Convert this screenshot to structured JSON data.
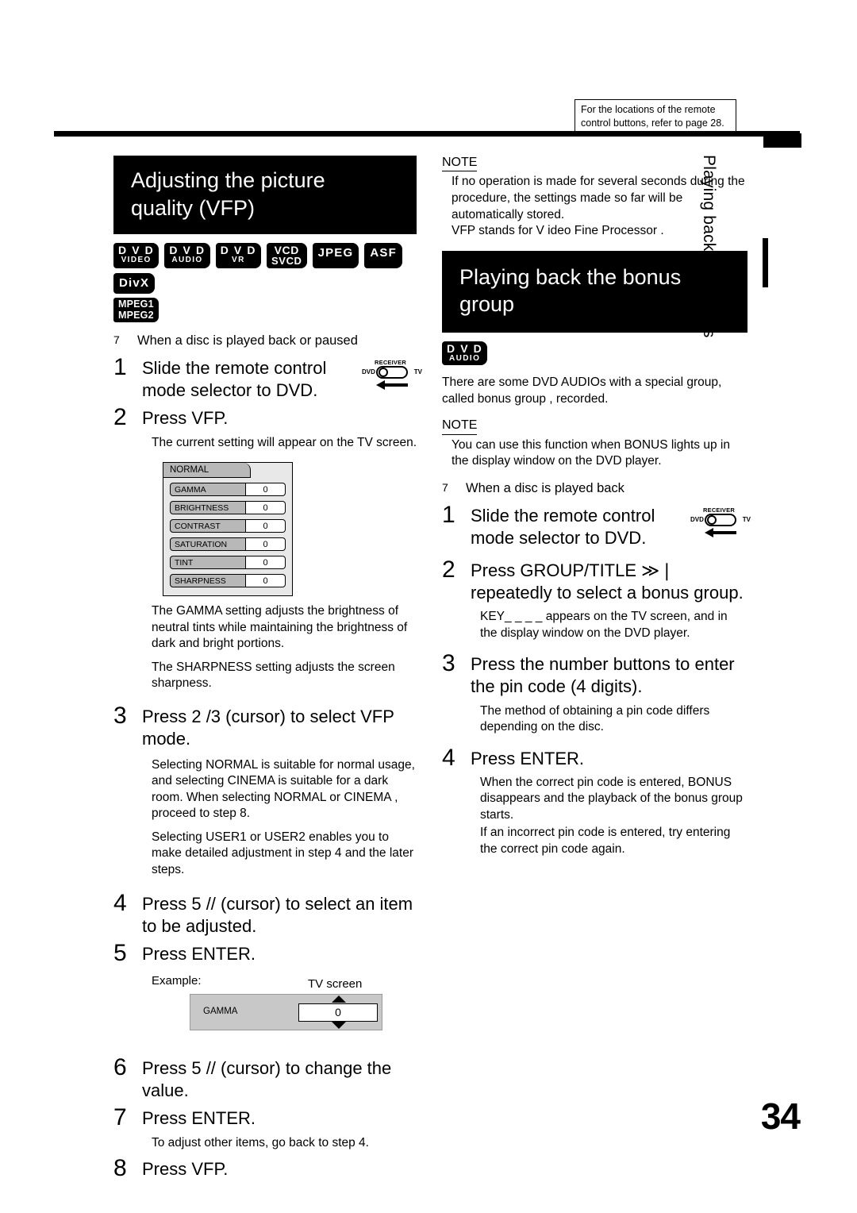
{
  "page": {
    "number": "34",
    "side_tab": "Playing back DVDs/CDs"
  },
  "remote_note": {
    "line1": "For the locations of the remote",
    "line2": "control buttons, refer to page 28."
  },
  "left_column": {
    "banner": {
      "line1": "Adjusting the picture",
      "line2": "quality (VFP)"
    },
    "badges": [
      {
        "top": "D V D",
        "bottom": "VIDEO"
      },
      {
        "top": "D V D",
        "bottom": "AUDIO"
      },
      {
        "top": "D V D",
        "bottom": "VR"
      },
      {
        "top": "VCD",
        "bottom": "SVCD"
      },
      {
        "top": "JPEG",
        "bottom": ""
      },
      {
        "top": "ASF",
        "bottom": ""
      },
      {
        "top": "DivX",
        "bottom": ""
      }
    ],
    "badges_row2": [
      {
        "top": "MPEG1",
        "bottom": "MPEG2"
      }
    ],
    "precondition": {
      "bullet": "7",
      "text": "When a disc is played back or paused"
    },
    "steps": [
      {
        "num": "1",
        "text": "Slide the remote control mode selector to DVD."
      },
      {
        "num": "2",
        "text": "Press VFP."
      },
      {
        "num": "3",
        "text": "Press  2 /3  (cursor) to select VFP mode."
      },
      {
        "num": "4",
        "text": "Press 5 //   (cursor) to select an item to be adjusted."
      },
      {
        "num": "5",
        "text": "Press ENTER."
      },
      {
        "num": "6",
        "text": "Press  5 //   (cursor) to change the value."
      },
      {
        "num": "7",
        "text": "Press ENTER."
      },
      {
        "num": "8",
        "text": "Press VFP."
      }
    ],
    "step2_note": "The current setting will appear on the TV screen.",
    "osd_menu": {
      "mode": "NORMAL",
      "rows": [
        {
          "label": "GAMMA",
          "value": "0"
        },
        {
          "label": "BRIGHTNESS",
          "value": "0"
        },
        {
          "label": "CONTRAST",
          "value": "0"
        },
        {
          "label": "SATURATION",
          "value": "0"
        },
        {
          "label": "TINT",
          "value": "0"
        },
        {
          "label": "SHARPNESS",
          "value": "0"
        }
      ]
    },
    "gamma_note": "The  GAMMA  setting adjusts the brightness of neutral tints while maintaining the brightness of dark and bright portions.",
    "sharpness_note": "The  SHARPNESS  setting adjusts the screen sharpness.",
    "step3_note_1": "Selecting  NORMAL  is suitable for normal usage, and selecting  CINEMA  is suitable for a dark room. When selecting  NORMAL  or  CINEMA , proceed to step 8.",
    "step3_note_2": "Selecting  USER1  or  USER2  enables you to make detailed adjustment in step 4 and the later steps.",
    "example": {
      "label": "Example:",
      "tv_screen_label": "TV screen",
      "item": "GAMMA",
      "value": "0"
    },
    "step7_note": "To adjust other items, go back to step 4."
  },
  "right_column": {
    "note1": {
      "head": "NOTE",
      "line1": "If no operation is made for several seconds during the procedure, the settings made so far will be automatically stored.",
      "line2": " VFP  stands for  V ideo Fine Processor ."
    },
    "banner": {
      "line1": "Playing back the bonus",
      "line2": "group"
    },
    "badge": {
      "top": "D V D",
      "bottom": "AUDIO"
    },
    "intro": "There are some DVD AUDIOs with a special group, called  bonus group , recorded.",
    "note2": {
      "head": "NOTE",
      "text": "You can use this function when  BONUS  lights up in the display window on the DVD player."
    },
    "precondition": {
      "bullet": "7",
      "text": "When a disc is played back"
    },
    "steps": [
      {
        "num": "1",
        "text": "Slide the remote control mode selector to DVD."
      },
      {
        "num": "2",
        "text": "Press GROUP/TITLE  ≫❘ repeatedly to select a bonus group."
      },
      {
        "num": "3",
        "text": "Press the number buttons to enter the pin code (4 digits)."
      },
      {
        "num": "4",
        "text": "Press ENTER."
      }
    ],
    "step2_note": " KEY_ _ _ _  appears on the TV screen, and in the display window on the DVD player.",
    "step3_note": "The method of obtaining a pin code differs depending on the disc.",
    "step4_note_1": "When the correct pin code is entered,  BONUS  disappears and the playback of the bonus group starts.",
    "step4_note_2": "If an incorrect pin code is entered, try entering the correct pin code again."
  },
  "mode_selector": {
    "receiver": "RECEIVER",
    "dvd": "DVD",
    "tv": "TV"
  }
}
